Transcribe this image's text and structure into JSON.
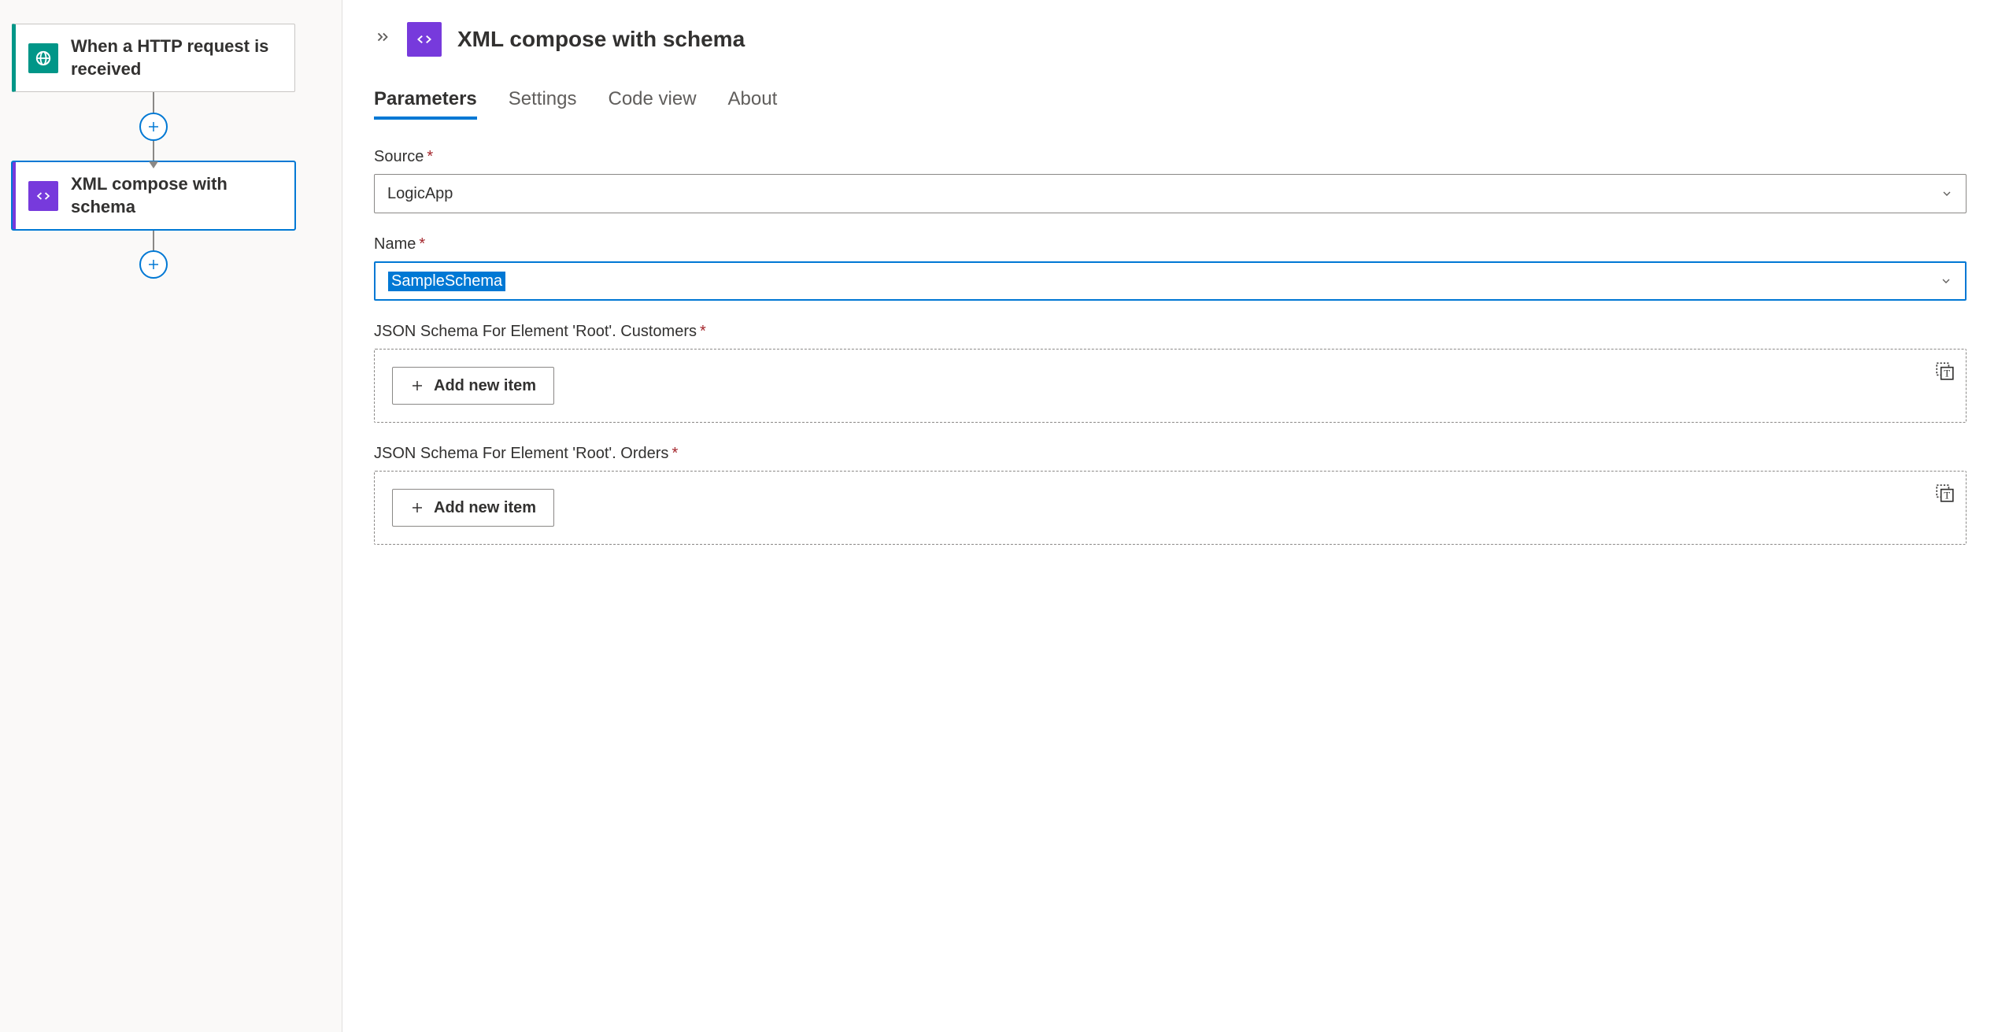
{
  "canvas": {
    "trigger": {
      "title": "When a HTTP request is received"
    },
    "action": {
      "title": "XML compose with schema"
    }
  },
  "details": {
    "title": "XML compose with schema",
    "tabs": {
      "parameters": "Parameters",
      "settings": "Settings",
      "codeview": "Code view",
      "about": "About"
    },
    "fields": {
      "source": {
        "label": "Source",
        "value": "LogicApp"
      },
      "name": {
        "label": "Name",
        "value": "SampleSchema"
      },
      "customers": {
        "label": "JSON Schema For Element 'Root'. Customers",
        "addLabel": "Add new item"
      },
      "orders": {
        "label": "JSON Schema For Element 'Root'. Orders",
        "addLabel": "Add new item"
      }
    }
  }
}
